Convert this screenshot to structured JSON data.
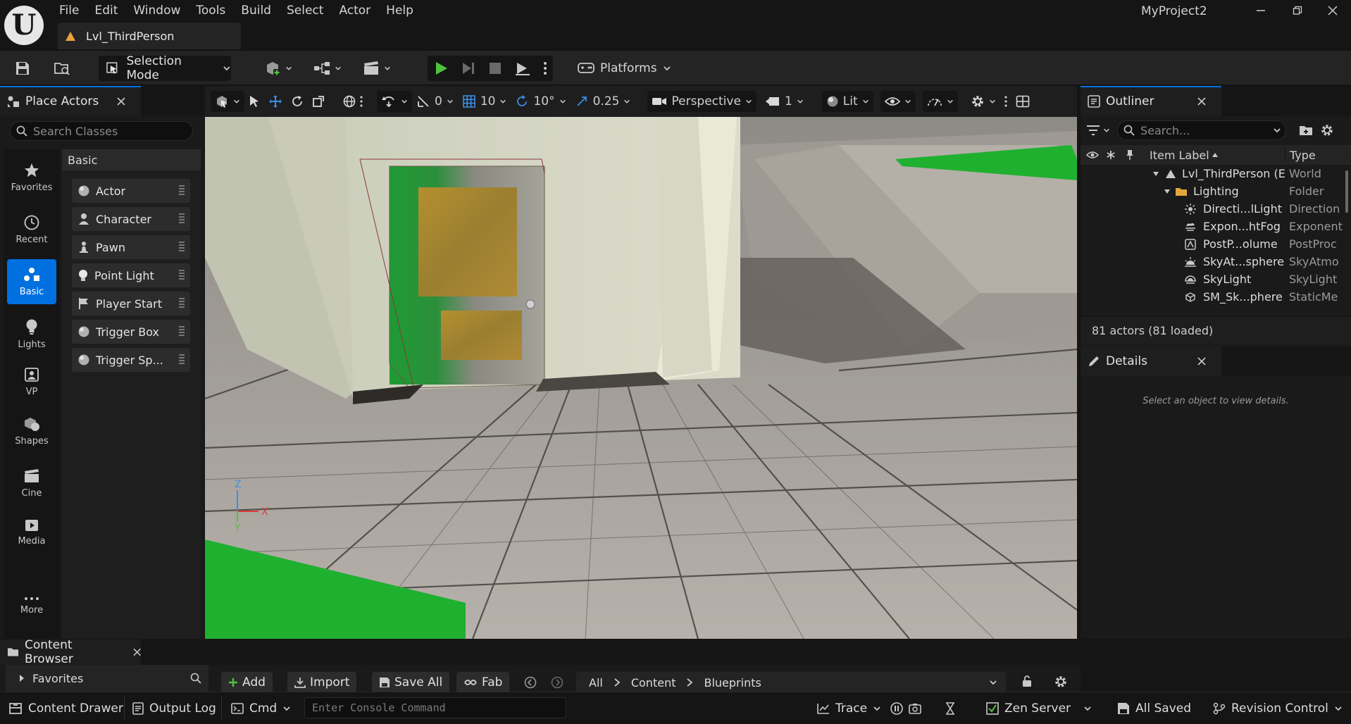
{
  "app": {
    "project_name": "MyProject2",
    "level_tab": "Lvl_ThirdPerson",
    "menus": [
      "File",
      "Edit",
      "Window",
      "Tools",
      "Build",
      "Select",
      "Actor",
      "Help"
    ]
  },
  "toolbar": {
    "selection_mode": "Selection Mode",
    "platforms": "Platforms"
  },
  "place_actors": {
    "title": "Place Actors",
    "search_placeholder": "Search Classes",
    "categories": [
      "Favorites",
      "Recent",
      "Basic",
      "Lights",
      "VP",
      "Shapes",
      "Cine",
      "Media",
      "More"
    ],
    "active_category": "Basic",
    "section_header": "Basic",
    "items": [
      "Actor",
      "Character",
      "Pawn",
      "Point Light",
      "Player Start",
      "Trigger Box",
      "Trigger Sp..."
    ]
  },
  "viewport": {
    "snap_rotate_value": "0",
    "grid_snap": "10",
    "rotation_snap": "10°",
    "scale_snap": "0.25",
    "view_mode": "Perspective",
    "camera_speed": "1",
    "lighting_mode": "Lit",
    "axis_labels": {
      "z": "Z",
      "x": "X",
      "y": "Y"
    }
  },
  "outliner": {
    "title": "Outliner",
    "search_placeholder": "Search...",
    "col_label": "Item Label",
    "col_type": "Type",
    "rows": [
      {
        "label": "Lvl_ThirdPerson (E",
        "type": "World",
        "icon": "level-icon",
        "indent": 1
      },
      {
        "label": "Lighting",
        "type": "Folder",
        "icon": "folder-icon",
        "indent": 2
      },
      {
        "label": "Directi...lLight",
        "type": "Direction",
        "icon": "sun-icon",
        "indent": 3
      },
      {
        "label": "Expon...htFog",
        "type": "Exponent",
        "icon": "fog-icon",
        "indent": 3
      },
      {
        "label": "PostP...olume",
        "type": "PostProc",
        "icon": "postprocess-icon",
        "indent": 3
      },
      {
        "label": "SkyAt...sphere",
        "type": "SkyAtmo",
        "icon": "sky-atmosphere-icon",
        "indent": 3
      },
      {
        "label": "SkyLight",
        "type": "SkyLight",
        "icon": "skylight-icon",
        "indent": 3
      },
      {
        "label": "SM_Sk...phere",
        "type": "StaticMe",
        "icon": "static-mesh-icon",
        "indent": 3
      }
    ],
    "status": "81 actors (81 loaded)"
  },
  "details": {
    "title": "Details",
    "empty_message": "Select an object to view details."
  },
  "content_browser": {
    "title": "Content Browser",
    "favorites": "Favorites",
    "add": "Add",
    "import": "Import",
    "save_all": "Save All",
    "fab": "Fab",
    "breadcrumb": [
      "All",
      "Content",
      "Blueprints"
    ]
  },
  "statusbar": {
    "content_drawer": "Content Drawer",
    "output_log": "Output Log",
    "cmd": "Cmd",
    "console_placeholder": "Enter Console Command",
    "trace": "Trace",
    "zen_server": "Zen Server",
    "all_saved": "All Saved",
    "revision_control": "Revision Control"
  },
  "colors": {
    "accent": "#0070e0",
    "play_green": "#4ec43c",
    "scene_green": "#1fb030"
  }
}
